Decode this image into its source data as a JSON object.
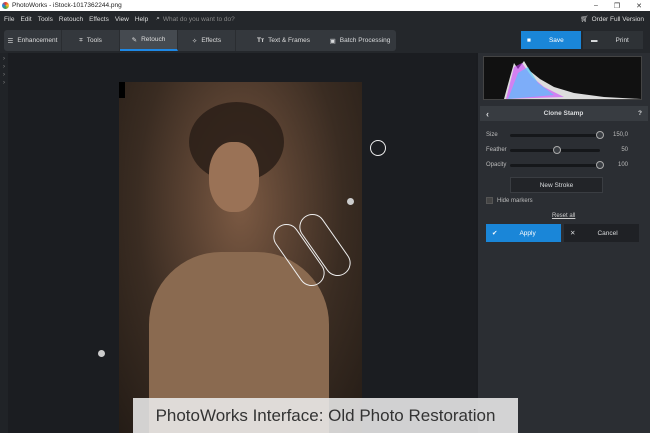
{
  "window": {
    "title": "PhotoWorks - iStock-1017362244.png",
    "min": "–",
    "max": "❐",
    "close": "✕"
  },
  "menu": {
    "items": [
      "File",
      "Edit",
      "Tools",
      "Retouch",
      "Effects",
      "View",
      "Help"
    ],
    "search_placeholder": "What do you want to do?",
    "order": "Order Full Version"
  },
  "toolbar": {
    "tabs": [
      {
        "label": "Enhancement",
        "icon": "sliders-icon"
      },
      {
        "label": "Tools",
        "icon": "crop-icon"
      },
      {
        "label": "Retouch",
        "icon": "brush-icon",
        "active": true
      },
      {
        "label": "Effects",
        "icon": "wand-icon"
      },
      {
        "label": "Text & Frames",
        "icon": "text-icon"
      }
    ],
    "batch": "Batch Processing",
    "save": "Save",
    "print": "Print",
    "accent": "#1a86d8"
  },
  "panel": {
    "title": "Clone Stamp",
    "help": "?",
    "sliders": [
      {
        "label": "Size",
        "value": "150,0",
        "level": 1.0
      },
      {
        "label": "Feather",
        "value": "50",
        "level": 0.52
      },
      {
        "label": "Opacity",
        "value": "100",
        "level": 1.0
      }
    ],
    "new_stroke": "New Stroke",
    "hide_markers": "Hide markers",
    "hide_markers_checked": false,
    "reset": "Reset all",
    "apply": "Apply",
    "cancel": "Cancel"
  },
  "caption": "PhotoWorks Interface: Old Photo Restoration"
}
